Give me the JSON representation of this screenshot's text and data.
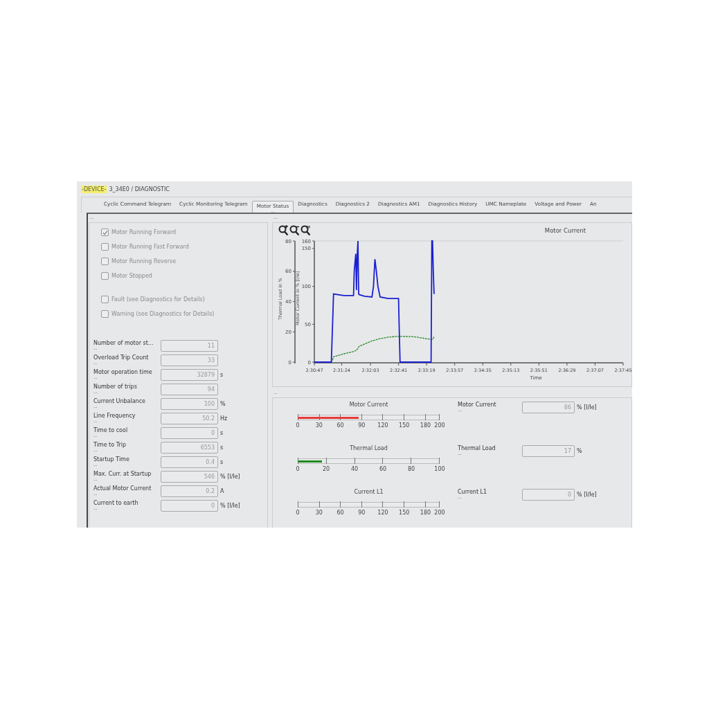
{
  "breadcrumb": {
    "device_tag": "-DEVICE-",
    "path": "3_34E0 / DIAGNOSTIC"
  },
  "tabs": [
    {
      "label": "Cyclic Command Telegram",
      "selected": false
    },
    {
      "label": "Cyclic Monitoring Telegram",
      "selected": false
    },
    {
      "label": "Motor Status",
      "selected": true,
      "more": "..."
    },
    {
      "label": "Diagnostics",
      "selected": false
    },
    {
      "label": "Diagnostics 2",
      "selected": false
    },
    {
      "label": "Diagnostics AM1",
      "selected": false
    },
    {
      "label": "Diagnostics History",
      "selected": false
    },
    {
      "label": "UMC Nameplate",
      "selected": false
    },
    {
      "label": "Voltage and Power",
      "selected": false
    },
    {
      "label": "An",
      "selected": false
    }
  ],
  "status_panel": {
    "more": "...",
    "status_flags": [
      {
        "label": "Motor Running Forward",
        "checked": true
      },
      {
        "label": "Motor Running Fast Forward",
        "checked": false
      },
      {
        "label": "Motor Running Reverse",
        "checked": false
      },
      {
        "label": "Motor Stopped",
        "checked": false
      }
    ],
    "alarm_flags": [
      {
        "label": "Fault (see Diagnostics for Details)",
        "checked": false
      },
      {
        "label": "Warning (see Diagnostics for Details)",
        "checked": false
      }
    ],
    "fields": [
      {
        "label": "Number of motor st...",
        "more": "...",
        "value": "11"
      },
      {
        "label": "Overload Trip Count",
        "more": "...",
        "value": "33"
      },
      {
        "label": "Motor operation time",
        "more": "...",
        "value": "32879",
        "unit": "s"
      },
      {
        "label": "Number of trips",
        "more": "...",
        "value": "94"
      },
      {
        "label": "Current Unbalance",
        "more": "...",
        "value": "100",
        "unit": "%"
      },
      {
        "label": "Line Frequency",
        "more": "...",
        "value": "50.2",
        "unit": "Hz"
      },
      {
        "label": "Time to cool",
        "more": "...",
        "value": "0",
        "unit": "s"
      },
      {
        "label": "Time to Trip",
        "more": "...",
        "value": "6553",
        "unit": "s"
      },
      {
        "label": "Startup Time",
        "more": "...",
        "value": "0.4",
        "unit": "s"
      },
      {
        "label": "Max. Curr. at Startup",
        "more": "...",
        "value": "546",
        "unit": "% [I/Ie]"
      },
      {
        "label": "Actual Motor Current",
        "more": "...",
        "value": "0.2",
        "unit": "A"
      },
      {
        "label": "Current to earth",
        "more": "...",
        "value": "0",
        "unit": "% [I/Ie]"
      }
    ]
  },
  "chart_panel": {
    "more": "...",
    "chart_data": {
      "type": "line",
      "title": "Motor Current",
      "xlabel": "Time",
      "ylabel": "Motor Current in % [I/Ie]",
      "y2label": "Thermal Load in %",
      "xlim": [
        9047,
        9465
      ],
      "ylim": [
        0,
        160
      ],
      "y2lim": [
        0,
        80
      ],
      "xticks": [
        {
          "value": 9047,
          "label": "2:30:47"
        },
        {
          "value": 9084,
          "label": "2:31:24"
        },
        {
          "value": 9123,
          "label": "2:32:03"
        },
        {
          "value": 9161,
          "label": "2:32:41"
        },
        {
          "value": 9199,
          "label": "2:33:19"
        },
        {
          "value": 9237,
          "label": "2:33:57"
        },
        {
          "value": 9275,
          "label": "2:34:35"
        },
        {
          "value": 9313,
          "label": "2:35:13"
        },
        {
          "value": 9351,
          "label": "2:35:51"
        },
        {
          "value": 9389,
          "label": "2:36:29"
        },
        {
          "value": 9427,
          "label": "2:37:07"
        },
        {
          "value": 9465,
          "label": "2:37:45"
        }
      ],
      "yticks": [
        0,
        50,
        100,
        150,
        160
      ],
      "y2ticks": [
        0,
        20,
        40,
        60,
        80
      ],
      "x": [
        9047,
        9070,
        9072,
        9073,
        9087,
        9100,
        9101,
        9103,
        9104,
        9105,
        9106,
        9107,
        9108,
        9115,
        9125,
        9127,
        9129,
        9131,
        9133,
        9136,
        9147,
        9161,
        9162,
        9163,
        9182,
        9205,
        9206,
        9207,
        9208,
        9209
      ],
      "series": [
        {
          "color": "#1a1fd0",
          "axis": "y",
          "line_style": "solid",
          "values": [
            0,
            0,
            60,
            90,
            88,
            88,
            120,
            143,
            95,
            140,
            160,
            90,
            89,
            87,
            86,
            100,
            136,
            120,
            100,
            86,
            84,
            84,
            40,
            0,
            0,
            0,
            160,
            160,
            120,
            90
          ]
        },
        {
          "color": "#2a8a2a",
          "axis": "y2",
          "line_style": "dashed",
          "values": [
            0,
            0,
            2,
            3.5,
            5.5,
            7,
            7.2,
            7.6,
            8,
            8.5,
            9,
            10,
            10.5,
            12,
            14,
            14.3,
            14.5,
            14.8,
            15.2,
            15.5,
            16.5,
            17,
            17.2,
            17,
            16.8,
            15,
            15,
            15.2,
            15.5,
            17
          ]
        }
      ]
    }
  },
  "gauge_panel": {
    "more": "...",
    "gauges": [
      {
        "title": "Motor Current",
        "level": 0.43,
        "color": "#e83a3a",
        "ticks": [
          "0",
          "30",
          "60",
          "90",
          "120",
          "150",
          "180",
          "200"
        ],
        "label": "Motor Current",
        "more": "...",
        "value": "86",
        "unit": "% [I/Ie]"
      },
      {
        "title": "Thermal Load",
        "level": 0.17,
        "color": "#1e8a1e",
        "ticks": [
          "0",
          "20",
          "40",
          "60",
          "80",
          "100"
        ],
        "label": "Thermal Load",
        "more": "...",
        "value": "17",
        "unit": "%"
      },
      {
        "title": "Current L1",
        "level": 0,
        "ticks": [
          "0",
          "30",
          "60",
          "90",
          "120",
          "150",
          "180",
          "200"
        ],
        "label": "Current L1",
        "more": "...",
        "value": "0",
        "unit": "% [I/Ie]"
      }
    ]
  }
}
